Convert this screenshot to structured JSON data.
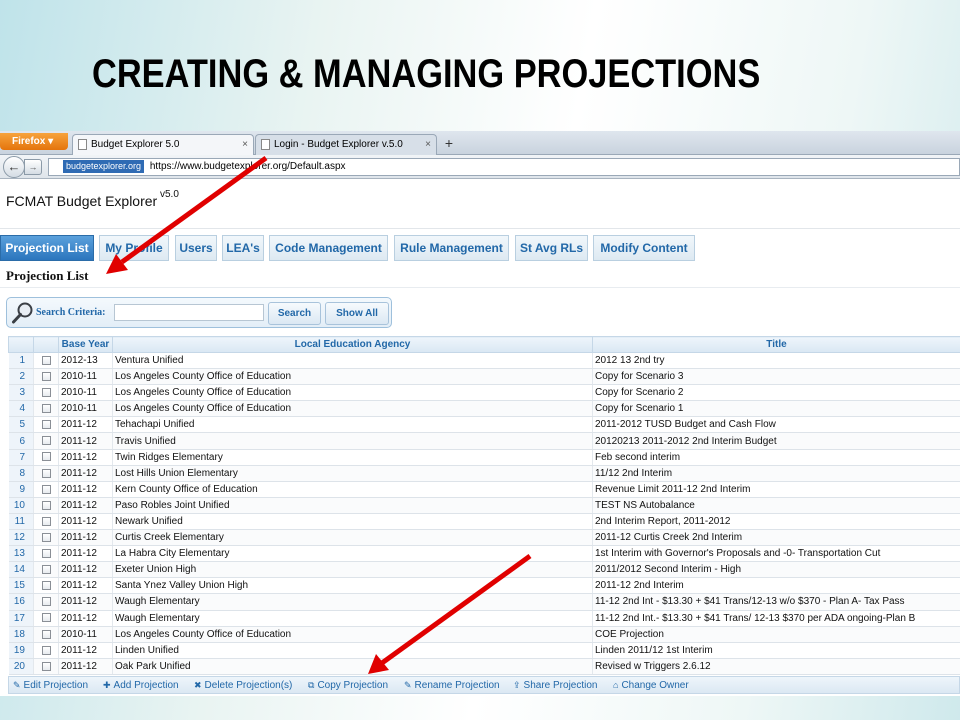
{
  "slide": {
    "title": "CREATING & MANAGING PROJECTIONS"
  },
  "browser": {
    "firefox_label": "Firefox",
    "tabs": [
      {
        "label": "Budget Explorer 5.0",
        "close": "×"
      },
      {
        "label": "Login - Budget Explorer v.5.0",
        "close": "×"
      }
    ],
    "new_tab": "+",
    "back": "←",
    "forward": "→",
    "url_site": "budgetexplorer.org",
    "url": "https://www.budgetexplorer.org/Default.aspx"
  },
  "app": {
    "name": "FCMAT Budget Explorer",
    "version": "v5.0",
    "tabs": [
      "Projection List",
      "My Profile",
      "Users",
      "LEA's",
      "Code Management",
      "Rule Management",
      "St Avg RLs",
      "Modify Content"
    ],
    "active_tab": 0
  },
  "page_title": "Projection List",
  "search": {
    "label": "Search Criteria:",
    "value": "",
    "search_button": "Search",
    "show_all_button": "Show All"
  },
  "grid": {
    "columns": [
      "",
      "",
      "Base Year",
      "Local Education Agency",
      "Title"
    ],
    "rows": [
      [
        "1",
        "2012-13",
        "Ventura Unified",
        "2012 13 2nd try"
      ],
      [
        "2",
        "2010-11",
        "Los Angeles County Office of Education",
        "Copy for Scenario 3"
      ],
      [
        "3",
        "2010-11",
        "Los Angeles County Office of Education",
        "Copy for Scenario 2"
      ],
      [
        "4",
        "2010-11",
        "Los Angeles County Office of Education",
        "Copy for Scenario 1"
      ],
      [
        "5",
        "2011-12",
        "Tehachapi Unified",
        "2011-2012 TUSD Budget and Cash Flow"
      ],
      [
        "6",
        "2011-12",
        "Travis Unified",
        "20120213 2011-2012 2nd Interim Budget"
      ],
      [
        "7",
        "2011-12",
        "Twin Ridges Elementary",
        "Feb second interim"
      ],
      [
        "8",
        "2011-12",
        "Lost Hills Union Elementary",
        "11/12 2nd Interim"
      ],
      [
        "9",
        "2011-12",
        "Kern County Office of Education",
        "Revenue Limit 2011-12 2nd Interim"
      ],
      [
        "10",
        "2011-12",
        "Paso Robles Joint Unified",
        "TEST NS Autobalance"
      ],
      [
        "11",
        "2011-12",
        "Newark Unified",
        "2nd Interim Report, 2011-2012"
      ],
      [
        "12",
        "2011-12",
        "Curtis Creek Elementary",
        "2011-12 Curtis Creek 2nd Interim"
      ],
      [
        "13",
        "2011-12",
        "La Habra City Elementary",
        "1st Interim with Governor's Proposals and -0- Transportation Cut"
      ],
      [
        "14",
        "2011-12",
        "Exeter Union High",
        "2011/2012 Second Interim - High"
      ],
      [
        "15",
        "2011-12",
        "Santa Ynez Valley Union High",
        "2011-12 2nd Interim"
      ],
      [
        "16",
        "2011-12",
        "Waugh Elementary",
        "11-12 2nd Int - $13.30 + $41 Trans/12-13 w/o $370 - Plan A- Tax Pass"
      ],
      [
        "17",
        "2011-12",
        "Waugh Elementary",
        "11-12 2nd Int.- $13.30 + $41 Trans/ 12-13 $370 per ADA ongoing-Plan B"
      ],
      [
        "18",
        "2010-11",
        "Los Angeles County Office of Education",
        "COE Projection"
      ],
      [
        "19",
        "2011-12",
        "Linden Unified",
        "Linden 2011/12 1st Interim"
      ],
      [
        "20",
        "2011-12",
        "Oak Park Unified",
        "Revised w Triggers 2.6.12"
      ]
    ]
  },
  "footer": {
    "buttons": [
      {
        "icon": "✎",
        "label": "Edit Projection"
      },
      {
        "icon": "✚",
        "label": "Add Projection"
      },
      {
        "icon": "✖",
        "label": "Delete Projection(s)"
      },
      {
        "icon": "⧉",
        "label": "Copy Projection"
      },
      {
        "icon": "✎",
        "label": "Rename Projection"
      },
      {
        "icon": "⇪",
        "label": "Share Projection"
      },
      {
        "icon": "⌂",
        "label": "Change Owner"
      }
    ]
  },
  "colors": {
    "accent": "#2268a8",
    "active_tab": "#2b75bd",
    "arrow": "#e00000",
    "firefox": "#e4740c"
  }
}
